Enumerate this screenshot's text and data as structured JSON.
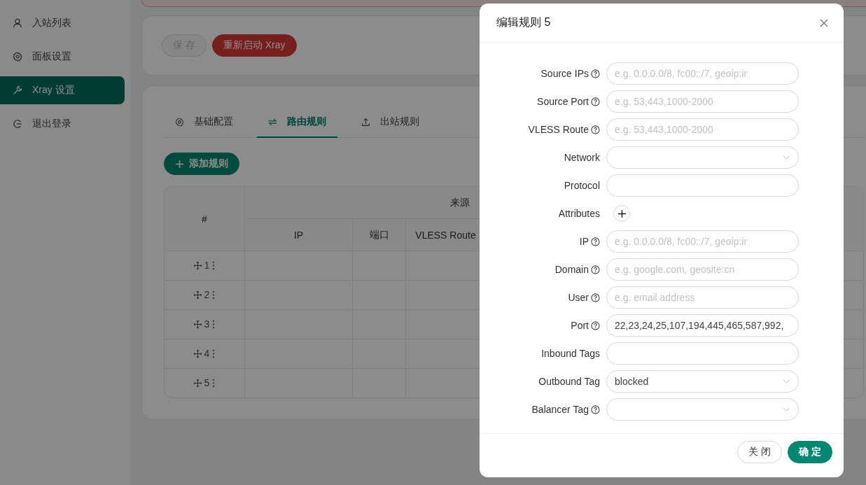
{
  "sidebar": {
    "items": [
      {
        "label": "入站列表",
        "selected": false
      },
      {
        "label": "面板设置",
        "selected": false
      },
      {
        "label": "Xray 设置",
        "selected": true
      },
      {
        "label": "退出登录",
        "selected": false
      }
    ]
  },
  "actions": [
    {
      "label": "保 存",
      "kind": "default",
      "disabled": true
    },
    {
      "label": "重新启动 Xray",
      "kind": "danger",
      "disabled": false
    }
  ],
  "tabs": [
    {
      "label": "基础配置",
      "selected": false
    },
    {
      "label": "路由规则",
      "selected": true
    },
    {
      "label": "出站规则",
      "selected": false
    }
  ],
  "add_button": {
    "label": "添加规则"
  },
  "table": {
    "index_header": "#",
    "group_header": "来源",
    "columns": [
      "IP",
      "端口",
      "VLESS Route"
    ],
    "rows": [
      {
        "index": "1"
      },
      {
        "index": "2"
      },
      {
        "index": "3"
      },
      {
        "index": "4"
      },
      {
        "index": "5"
      }
    ]
  },
  "dialog": {
    "title": "编辑规则 5",
    "fields": [
      {
        "label": "Source IPs",
        "help": true,
        "kind": "input",
        "placeholder": "e.g. 0.0.0.0/8, fc00::/7, geoip:ir"
      },
      {
        "label": "Source Port",
        "help": true,
        "kind": "input",
        "placeholder": "e.g. 53,443,1000-2000"
      },
      {
        "label": "VLESS Route",
        "help": true,
        "kind": "input",
        "placeholder": "e.g. 53,443,1000-2000"
      },
      {
        "label": "Network",
        "help": false,
        "kind": "select"
      },
      {
        "label": "Protocol",
        "help": false,
        "kind": "input"
      },
      {
        "label": "Attributes",
        "help": false,
        "kind": "add"
      },
      {
        "label": "IP",
        "help": true,
        "kind": "input",
        "placeholder": "e.g. 0.0.0.0/8, fc00::/7, geoip:ir"
      },
      {
        "label": "Domain",
        "help": true,
        "kind": "input",
        "placeholder": "e.g. google.com, geosite:cn"
      },
      {
        "label": "User",
        "help": true,
        "kind": "input",
        "placeholder": "e.g. email address"
      },
      {
        "label": "Port",
        "help": true,
        "kind": "input",
        "value": "22,23,24,25,107,194,445,465,587,992,"
      },
      {
        "label": "Inbound Tags",
        "help": false,
        "kind": "input"
      },
      {
        "label": "Outbound Tag",
        "help": false,
        "kind": "select",
        "value": "blocked"
      },
      {
        "label": "Balancer Tag",
        "help": true,
        "kind": "select"
      }
    ],
    "buttons": [
      {
        "label": "关 闭",
        "kind": "default"
      },
      {
        "label": "确 定",
        "kind": "primary"
      }
    ]
  }
}
